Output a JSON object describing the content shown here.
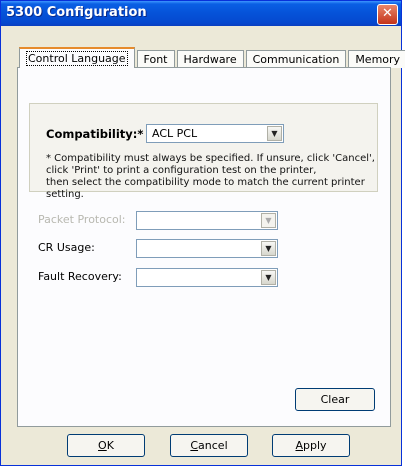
{
  "window": {
    "title": "5300 Configuration"
  },
  "tabs": [
    {
      "label": "Control Language",
      "active": true
    },
    {
      "label": "Font",
      "active": false
    },
    {
      "label": "Hardware",
      "active": false
    },
    {
      "label": "Communication",
      "active": false
    },
    {
      "label": "Memory",
      "active": false
    }
  ],
  "compatibility": {
    "label": "Compatibility:*",
    "value": "ACL PCL",
    "note_line1": "* Compatibility must always be specified. If unsure, click 'Cancel',",
    "note_line2": "click 'Print' to print a configuration test on the printer,",
    "note_line3": "then select the compatibility mode to match the current printer setting."
  },
  "fields": {
    "packet_protocol": {
      "label": "Packet Protocol:",
      "value": "",
      "enabled": false
    },
    "cr_usage": {
      "label": "CR Usage:",
      "value": "",
      "enabled": true
    },
    "fault_recovery": {
      "label": "Fault Recovery:",
      "value": "",
      "enabled": true
    }
  },
  "buttons": {
    "clear": "Clear",
    "ok_mnemonic": "O",
    "ok_rest": "K",
    "cancel_mnemonic": "C",
    "cancel_rest": "ancel",
    "apply_mnemonic": "A",
    "apply_rest": "pply"
  }
}
